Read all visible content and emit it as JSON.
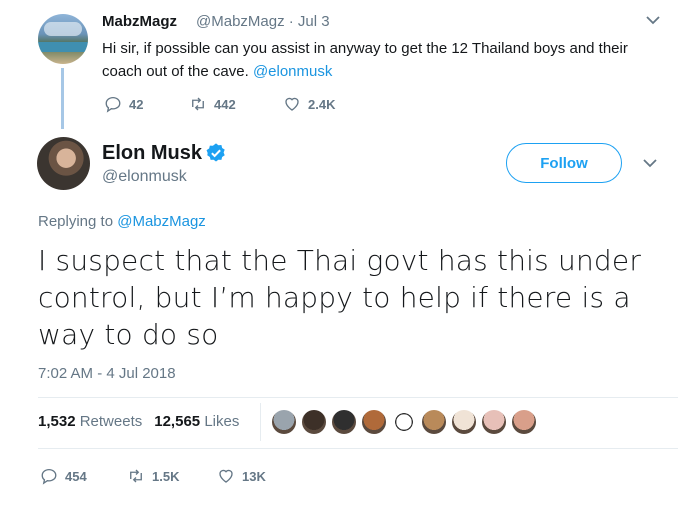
{
  "reply_tweet": {
    "name": "MabzMagz",
    "handle_time": "@MabzMagz · Jul 3",
    "text": "Hi sir, if possible can you assist in anyway to get the 12 Thailand boys and their coach out of the cave.",
    "mention": "@elonmusk",
    "actions": {
      "replies": "42",
      "retweets": "442",
      "likes": "2.4K"
    }
  },
  "main_tweet": {
    "name": "Elon Musk",
    "handle": "@elonmusk",
    "follow_label": "Follow",
    "replying_prefix": "Replying to",
    "replying_to": "@MabzMagz",
    "text": "I suspect that the Thai govt has this under control, but I’m happy to help if there is a way to do so",
    "timestamp": "7:02 AM - 4 Jul 2018",
    "stats": {
      "retweets_count": "1,532",
      "retweets_label": "Retweets",
      "likes_count": "12,565",
      "likes_label": "Likes"
    },
    "liker_colors": [
      "#9aa4ad",
      "#3d3028",
      "#2f2f2f",
      "#b06a3a",
      "#ffffff",
      "#b98a5a",
      "#f0e3d6",
      "#e7c0b8",
      "#d99f8a"
    ],
    "actions": {
      "replies": "454",
      "retweets": "1.5K",
      "likes": "13K"
    }
  },
  "icons": {
    "reply": "reply-icon",
    "retweet": "retweet-icon",
    "like": "heart-icon",
    "verified": "verified-badge-icon",
    "menu": "chevron-down-icon"
  },
  "colors": {
    "link": "#1b95e0",
    "accent": "#1da1f2",
    "muted": "#657786"
  }
}
